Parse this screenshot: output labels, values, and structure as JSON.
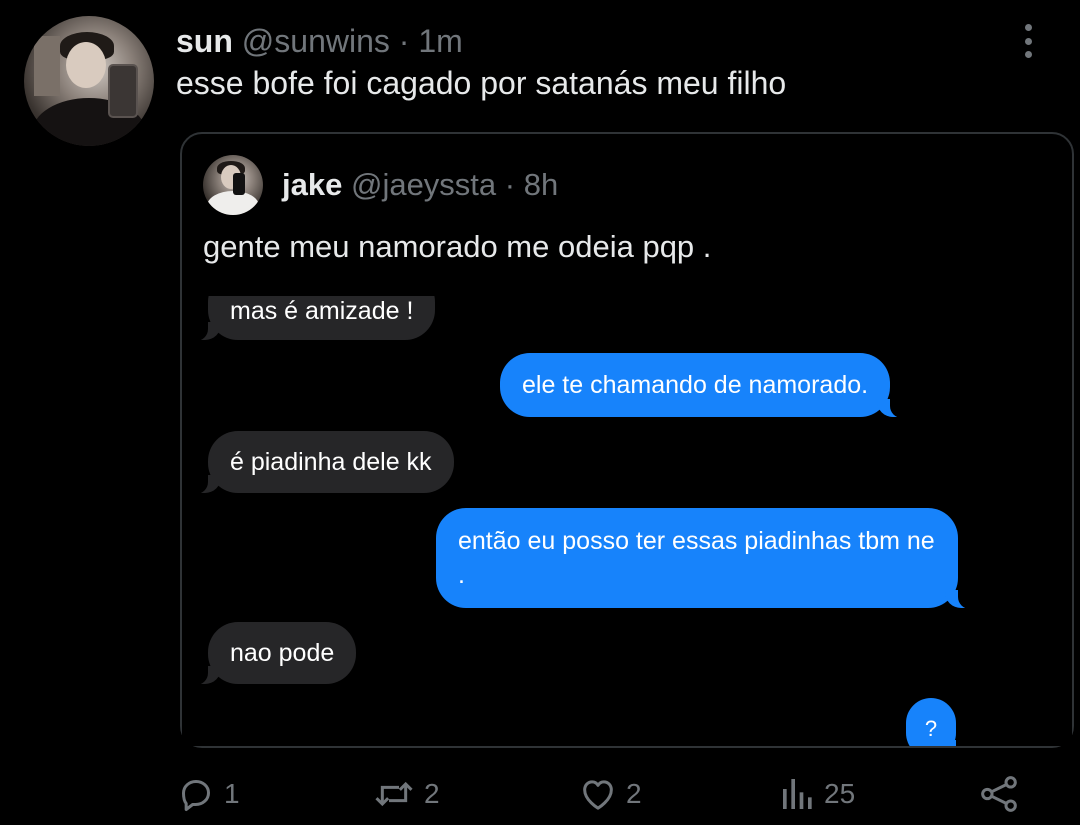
{
  "tweet": {
    "author_name": "sun",
    "author_handle": "@sunwins",
    "separator": "·",
    "time": "1m",
    "text": "esse bofe foi cagado por satanás meu filho"
  },
  "quoted": {
    "author_name": "jake",
    "author_handle": "@jaeyssta",
    "separator": "·",
    "time": "8h",
    "text": "gente meu namorado me odeia pqp ."
  },
  "chat_messages": [
    {
      "side": "in",
      "text": "mas é amizade !"
    },
    {
      "side": "out",
      "text": "ele te chamando de namorado."
    },
    {
      "side": "in",
      "text": "é piadinha dele kk"
    },
    {
      "side": "out",
      "text": "então eu posso ter essas piadinhas tbm ne ."
    },
    {
      "side": "in",
      "text": "nao pode"
    },
    {
      "side": "out",
      "text": "?"
    }
  ],
  "actions": {
    "reply_count": "1",
    "retweet_count": "2",
    "like_count": "2",
    "views_count": "25"
  },
  "icons": {
    "reply": "reply-icon",
    "retweet": "retweet-icon",
    "like": "heart-icon",
    "views": "views-icon",
    "share": "share-icon",
    "more": "more-icon"
  },
  "colors": {
    "background": "#000000",
    "text": "#e7e9ea",
    "muted": "#71767b",
    "border": "#2f3336",
    "bubble_in": "#262628",
    "bubble_out": "#1783fb"
  }
}
